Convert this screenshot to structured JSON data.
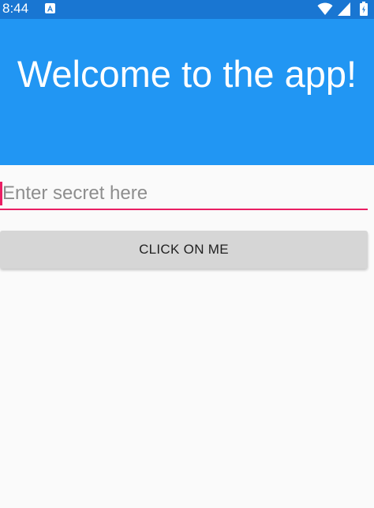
{
  "status_bar": {
    "time": "8:44",
    "app_notification_icon": "android-app-icon",
    "icons": [
      "wifi-icon",
      "cellular-signal-icon",
      "battery-icon"
    ]
  },
  "header": {
    "title": "Welcome to the app!"
  },
  "secret_field": {
    "value": "",
    "placeholder": "Enter secret here"
  },
  "action_button": {
    "label": "CLICK ON ME"
  },
  "colors": {
    "status_bar": "#1976d2",
    "header": "#2196f3",
    "accent": "#e91e63",
    "button": "#d6d6d6",
    "background": "#fafafa"
  }
}
